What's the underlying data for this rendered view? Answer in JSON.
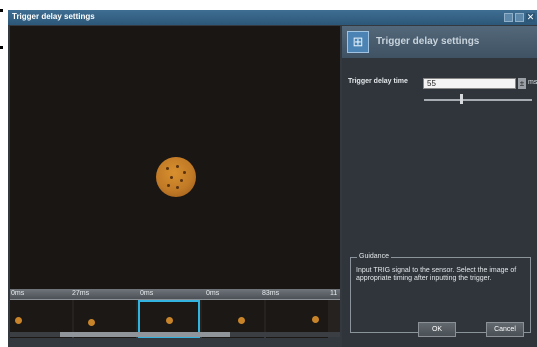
{
  "window": {
    "title": "Trigger delay settings"
  },
  "panel": {
    "title": "Trigger delay settings",
    "delay_label": "Trigger delay time",
    "delay_value": "55",
    "unit": "ms",
    "slider_level_fraction": 0.33
  },
  "filmstrip": {
    "time_labels": [
      "0ms",
      "27ms",
      "0ms",
      "0ms",
      "83ms",
      "11"
    ]
  },
  "guidance": {
    "label": "Guidance",
    "text": "Input TRIG signal to the sensor. Select the image of appropriate timing after inputting the trigger."
  },
  "buttons": {
    "ok": "OK",
    "cancel": "Cancel"
  },
  "colors": {
    "selection": "#33b4e0",
    "titlebar": "#2c5778",
    "panel": "#2f353b"
  },
  "icons": {
    "panel_icon": "trigger-settings-icon"
  }
}
